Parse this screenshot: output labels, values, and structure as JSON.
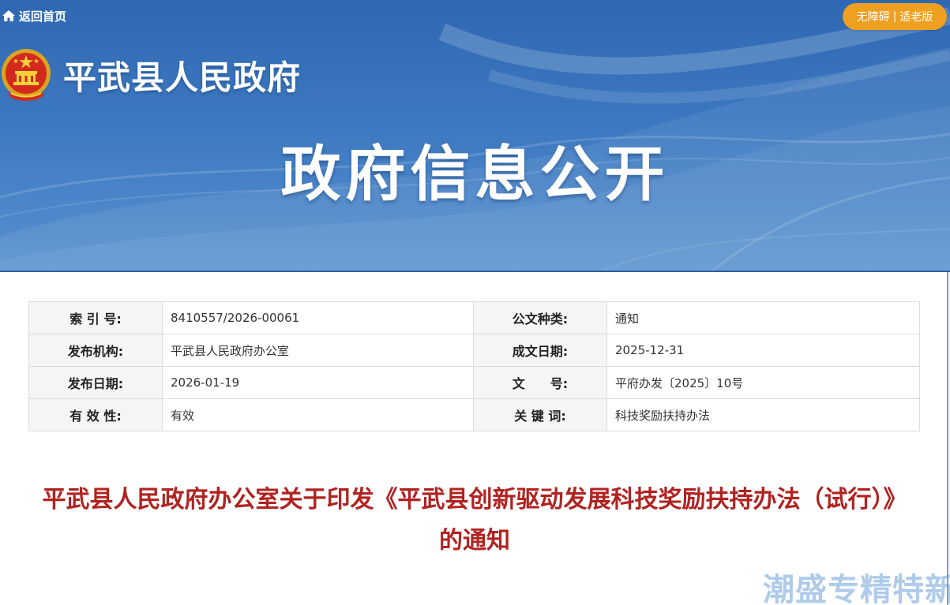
{
  "header": {
    "home_label": "返回首页",
    "accessibility": {
      "accessible_label": "无障碍",
      "separator": "|",
      "elderly_label": "适老版"
    },
    "gov_name": "平武县人民政府",
    "banner_title": "政府信息公开"
  },
  "meta": {
    "rows": [
      {
        "label1": "索 引 号:",
        "value1": "8410557/2026-00061",
        "label2": "公文种类:",
        "value2": "通知"
      },
      {
        "label1": "发布机构:",
        "value1": "平武县人民政府办公室",
        "label2": "成文日期:",
        "value2": "2025-12-31"
      },
      {
        "label1": "发布日期:",
        "value1": "2026-01-19",
        "label2": "文　　号:",
        "value2": "平府办发〔2025〕10号"
      },
      {
        "label1": "有 效 性:",
        "value1": "有效",
        "label2": "关 键 词:",
        "value2": "科技奖励扶持办法"
      }
    ]
  },
  "document": {
    "title": "平武县人民政府办公室关于印发《平武县创新驱动发展科技奖励扶持办法（试行）》的通知"
  },
  "watermark": {
    "text": "潮盛专精特新"
  },
  "icons": {
    "home": "home-icon",
    "emblem": "national-emblem-icon"
  },
  "colors": {
    "banner_blue": "#3c78c0",
    "accent_orange": "#f0a020",
    "title_red": "#b02321",
    "label_bg": "#f5f5f5",
    "border": "#dcdcdc"
  }
}
